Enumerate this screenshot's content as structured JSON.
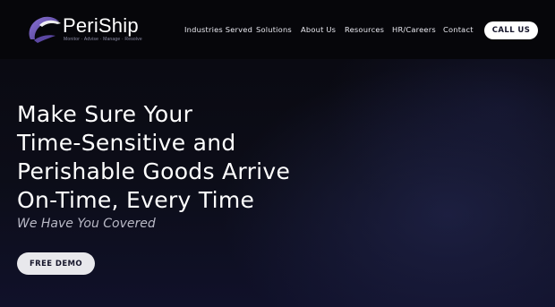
{
  "brand": {
    "name": "PeriShip",
    "tagline": "Monitor · Advise · Manage · Resolve"
  },
  "nav": {
    "items": [
      {
        "label": "Industries Served"
      },
      {
        "label": "Solutions"
      },
      {
        "label": "About Us"
      },
      {
        "label": "Resources"
      },
      {
        "label": "HR/Careers"
      },
      {
        "label": "Contact"
      }
    ],
    "cta_label": "CALL US"
  },
  "hero": {
    "headline_lines": [
      "Make Sure Your",
      "Time-Sensitive and",
      "Perishable Goods Arrive",
      "On-Time, Every Time"
    ],
    "subheadline": "We Have You Covered",
    "cta_label": "FREE DEMO"
  },
  "colors": {
    "background": "#0b0b13",
    "text": "#ffffff",
    "button_bg": "#ffffff",
    "button_text": "#14142a",
    "logo_accent": "#6f56b7"
  },
  "icons": {
    "logo_mark": "periship-swoosh-icon"
  }
}
